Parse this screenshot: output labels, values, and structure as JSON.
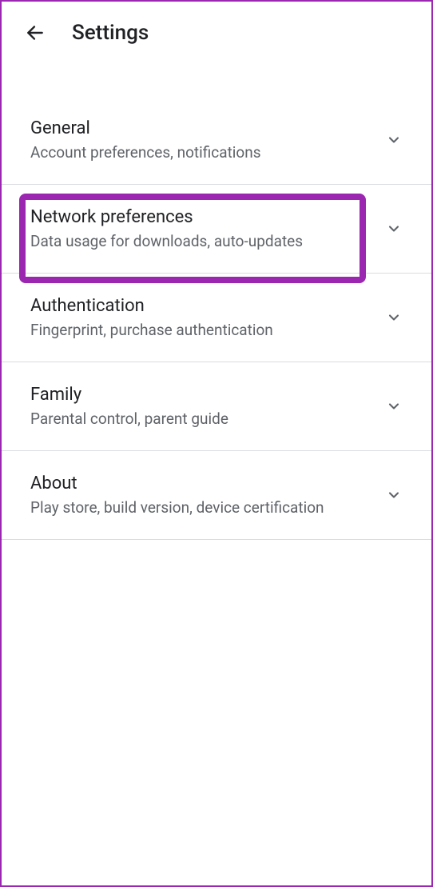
{
  "header": {
    "title": "Settings"
  },
  "items": [
    {
      "title": "General",
      "subtitle": "Account preferences, notifications"
    },
    {
      "title": "Network preferences",
      "subtitle": "Data usage for downloads, auto-updates"
    },
    {
      "title": "Authentication",
      "subtitle": "Fingerprint, purchase authentication"
    },
    {
      "title": "Family",
      "subtitle": "Parental control, parent guide"
    },
    {
      "title": "About",
      "subtitle": "Play store, build version, device certification"
    }
  ]
}
